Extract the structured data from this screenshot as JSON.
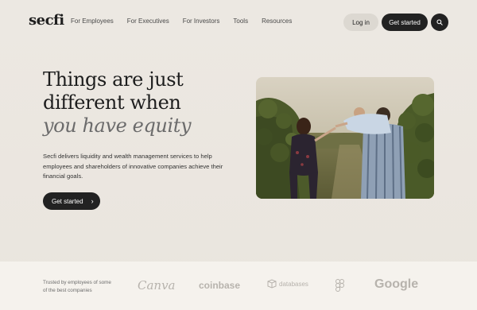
{
  "brand": {
    "logo": "secfi"
  },
  "nav": {
    "links": [
      "For Employees",
      "For Executives",
      "For Investors",
      "Tools",
      "Resources"
    ],
    "login": "Log in",
    "get_started": "Get started",
    "search_icon": "search-icon"
  },
  "hero": {
    "line1": "Things are just",
    "line2": "different when",
    "line3": "you have equity",
    "description": "Secfi delivers liquidity and wealth management services to help employees and shareholders of innovative companies achieve their financial goals.",
    "cta": "Get started",
    "cta_icon": "chevron-right-icon"
  },
  "trusted": {
    "text": "Trusted by employees of some of the best companies",
    "logos": [
      "Canva",
      "coinbase",
      "databases",
      "figma",
      "Google"
    ]
  },
  "colors": {
    "background": "#ece8e2",
    "dark_button": "#222222",
    "light_button": "#dcd8d1",
    "trusted_bar": "#f5f2ed",
    "logo_gray": "#b7b3ad"
  }
}
